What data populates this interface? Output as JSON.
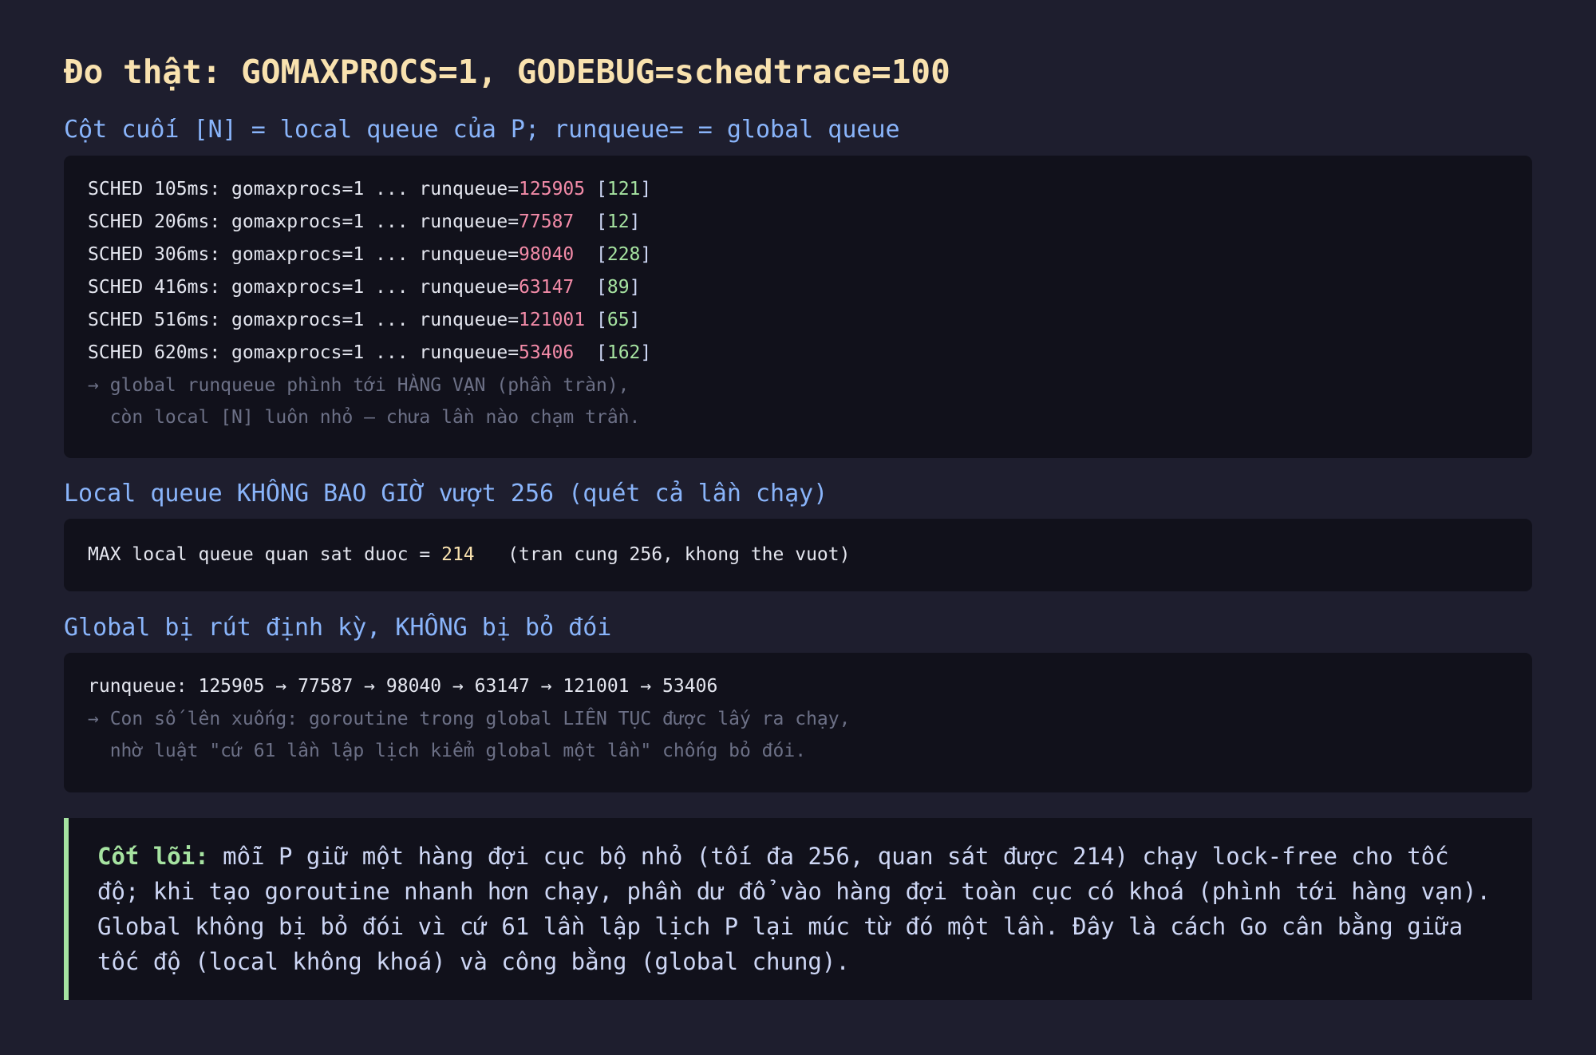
{
  "title": "Đo thật: GOMAXPROCS=1, GODEBUG=schedtrace=100",
  "section1": {
    "heading": "Cột cuối [N] = local queue của P; runqueue= = global queue",
    "rows": [
      {
        "prefix": "SCHED 105ms: gomaxprocs=1 ... runqueue=",
        "runqueue": "125905",
        "gap": " ",
        "local": "121"
      },
      {
        "prefix": "SCHED 206ms: gomaxprocs=1 ... runqueue=",
        "runqueue": "77587",
        "gap": "  ",
        "local": "12"
      },
      {
        "prefix": "SCHED 306ms: gomaxprocs=1 ... runqueue=",
        "runqueue": "98040",
        "gap": "  ",
        "local": "228"
      },
      {
        "prefix": "SCHED 416ms: gomaxprocs=1 ... runqueue=",
        "runqueue": "63147",
        "gap": "  ",
        "local": "89"
      },
      {
        "prefix": "SCHED 516ms: gomaxprocs=1 ... runqueue=",
        "runqueue": "121001",
        "gap": " ",
        "local": "65"
      },
      {
        "prefix": "SCHED 620ms: gomaxprocs=1 ... runqueue=",
        "runqueue": "53406",
        "gap": "  ",
        "local": "162"
      }
    ],
    "note_line1": "→ global runqueue phình tới HÀNG VẠN (phần tràn),",
    "note_line2": "  còn local [N] luôn nhỏ — chưa lần nào chạm trần."
  },
  "section2": {
    "heading": "Local queue KHÔNG BAO GIỜ vượt 256 (quét cả lần chạy)",
    "prefix": "MAX local queue quan sat duoc = ",
    "max_value": "214",
    "suffix": "   (tran cung 256, khong the vuot)"
  },
  "section3": {
    "heading": "Global bị rút định kỳ, KHÔNG bị bỏ đói",
    "sequence_line": "runqueue: 125905 → 77587 → 98040 → 63147 → 121001 → 53406",
    "note_line1": "→ Con số lên xuống: goroutine trong global LIÊN TỤC được lấy ra chạy,",
    "note_line2": "  nhờ luật \"cứ 61 lần lập lịch kiểm global một lần\" chống bỏ đói."
  },
  "core": {
    "label": "Cốt lõi:",
    "text": " mỗi P giữ một hàng đợi cục bộ nhỏ (tối đa 256, quan sát được 214) chạy lock-free cho tốc độ; khi tạo goroutine nhanh hơn chạy, phần dư đổ vào hàng đợi toàn cục có khoá (phình tới hàng vạn). Global không bị bỏ đói vì cứ 61 lần lập lịch P lại múc từ đó một lần. Đây là cách Go cân bằng giữa tốc độ (local không khoá) và công bằng (global chung)."
  },
  "colors": {
    "background": "#1e1e2e",
    "panel": "#11111b",
    "title": "#f9e2af",
    "heading": "#89b4fa",
    "global_value": "#f38ba8",
    "local_value": "#a6e3a1",
    "max_value": "#f9e2af",
    "accent_border": "#a6e3a1"
  }
}
